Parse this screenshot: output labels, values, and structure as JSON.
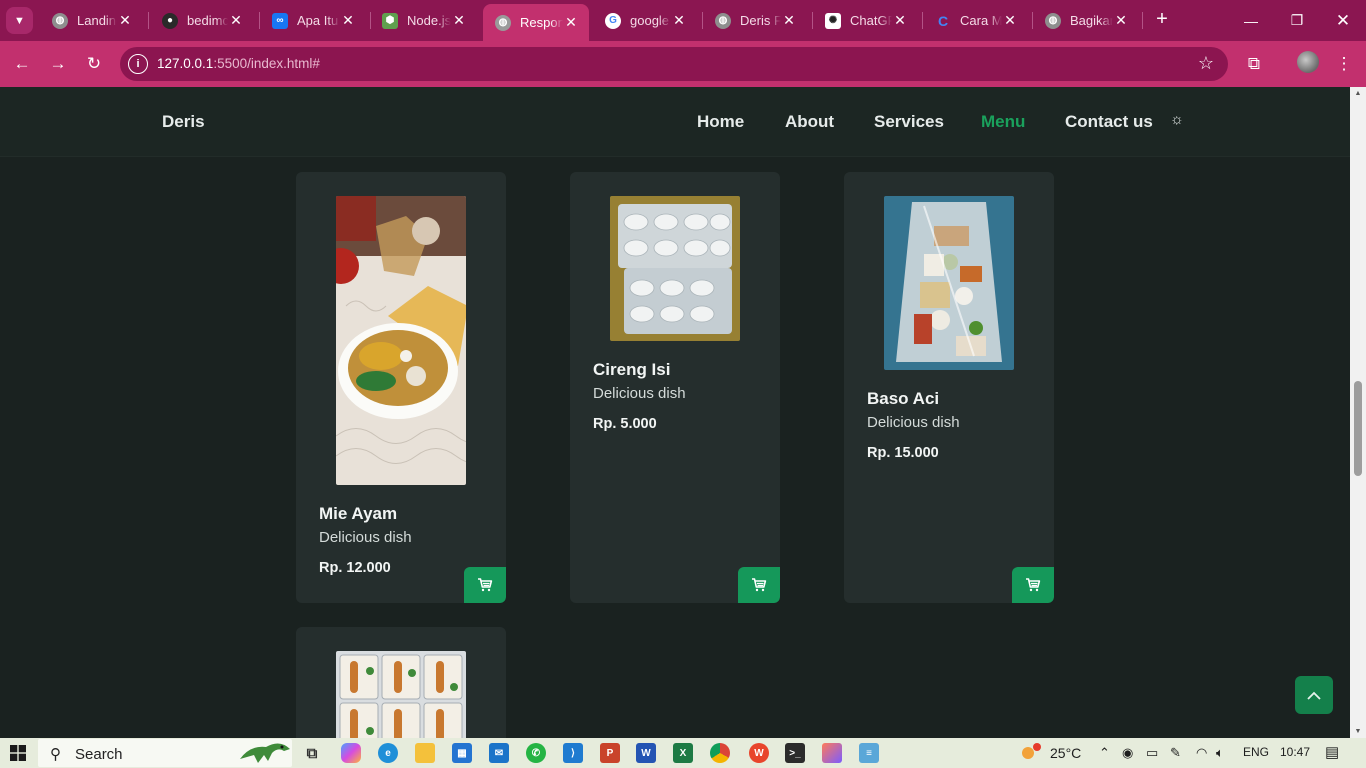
{
  "browser": {
    "tabs": [
      {
        "title": "Landing",
        "fav_color": "#a0a0a0",
        "active": false
      },
      {
        "title": "bedimc",
        "fav_color": "#2a2a2a",
        "active": false
      },
      {
        "title": "Apa Itu",
        "fav_color": "#1877f2",
        "active": false
      },
      {
        "title": "Node.js",
        "fav_color": "#5fa04e",
        "active": false
      },
      {
        "title": "Respon",
        "fav_color": "#a0a0a0",
        "active": true
      },
      {
        "title": "google",
        "fav_color": "#ffffff",
        "active": false
      },
      {
        "title": "Deris Fo",
        "fav_color": "#a0a0a0",
        "active": false
      },
      {
        "title": "ChatGP",
        "fav_color": "#ffffff",
        "active": false
      },
      {
        "title": "Cara M",
        "fav_color": "#4285f4",
        "active": false
      },
      {
        "title": "Bagikar",
        "fav_color": "#a0a0a0",
        "active": false
      }
    ],
    "url_host": "127.0.0.1",
    "url_rest": ":5500/index.html#"
  },
  "site": {
    "brand": "Deris",
    "nav": [
      {
        "label": "Home",
        "active": false
      },
      {
        "label": "About",
        "active": false
      },
      {
        "label": "Services",
        "active": false
      },
      {
        "label": "Menu",
        "active": true
      },
      {
        "label": "Contact us",
        "active": false
      }
    ],
    "menu_items": [
      {
        "name": "Mie Ayam",
        "desc": "Delicious dish",
        "price": "Rp. 12.000"
      },
      {
        "name": "Cireng Isi",
        "desc": "Delicious dish",
        "price": "Rp. 5.000"
      },
      {
        "name": "Baso Aci",
        "desc": "Delicious dish",
        "price": "Rp. 15.000"
      }
    ],
    "accent": "#15985a",
    "background": "#1a2220"
  },
  "taskbar": {
    "search_label": "Search",
    "weather": "25°C",
    "language": "ENG",
    "time": "10:47"
  }
}
